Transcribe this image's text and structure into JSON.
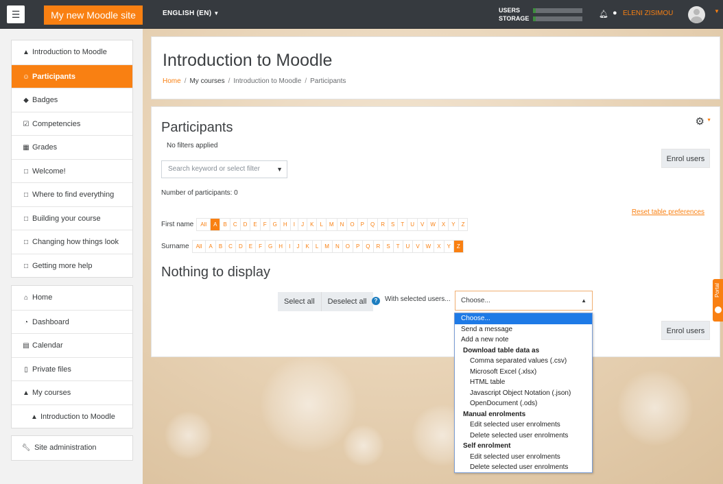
{
  "navbar": {
    "brand": "My new Moodle site",
    "language": "ENGLISH (EN)",
    "quota_users_label": "USERS",
    "quota_storage_label": "STORAGE",
    "quota_users_level": 0.05,
    "quota_storage_level": 0.05,
    "username": "ELENI ZISIMOU"
  },
  "drawer": {
    "course_items": [
      {
        "label": "Introduction to Moodle",
        "icon": "graduation-cap-icon",
        "active": false
      },
      {
        "label": "Participants",
        "icon": "users-icon",
        "active": true
      },
      {
        "label": "Badges",
        "icon": "shield-icon",
        "active": false
      },
      {
        "label": "Competencies",
        "icon": "checkbox-icon",
        "active": false
      },
      {
        "label": "Grades",
        "icon": "table-icon",
        "active": false
      },
      {
        "label": "Welcome!",
        "icon": "folder-icon",
        "active": false
      },
      {
        "label": "Where to find everything",
        "icon": "folder-icon",
        "active": false
      },
      {
        "label": "Building your course",
        "icon": "folder-icon",
        "active": false
      },
      {
        "label": "Changing how things look",
        "icon": "folder-icon",
        "active": false
      },
      {
        "label": "Getting more help",
        "icon": "folder-icon",
        "active": false
      }
    ],
    "site_items": [
      {
        "label": "Home",
        "icon": "home-icon"
      },
      {
        "label": "Dashboard",
        "icon": "dashboard-icon"
      },
      {
        "label": "Calendar",
        "icon": "calendar-icon"
      },
      {
        "label": "Private files",
        "icon": "file-icon"
      },
      {
        "label": "My courses",
        "icon": "graduation-cap-icon"
      },
      {
        "label": "Introduction to Moodle",
        "icon": "graduation-cap-icon"
      }
    ],
    "admin_item": {
      "label": "Site administration",
      "icon": "wrench-icon"
    }
  },
  "header": {
    "title": "Introduction to Moodle",
    "breadcrumb": [
      "Home",
      "My courses",
      "Introduction to Moodle",
      "Participants"
    ]
  },
  "participants": {
    "title": "Participants",
    "filters_status": "No filters applied",
    "search_placeholder": "Search keyword or select filter",
    "enrol_button": "Enrol users",
    "count_label": "Number of participants: 0",
    "reset_link": "Reset table preferences",
    "firstname_label": "First name",
    "surname_label": "Surname",
    "all_label": "All",
    "letters": [
      "A",
      "B",
      "C",
      "D",
      "E",
      "F",
      "G",
      "H",
      "I",
      "J",
      "K",
      "L",
      "M",
      "N",
      "O",
      "P",
      "Q",
      "R",
      "S",
      "T",
      "U",
      "V",
      "W",
      "X",
      "Y",
      "Z"
    ],
    "firstname_selected": "A",
    "surname_selected": "Z",
    "empty_message": "Nothing to display",
    "select_all": "Select all",
    "deselect_all": "Deselect all",
    "with_selected": "With selected users...",
    "select_value": "Choose..."
  },
  "bulk_options": [
    {
      "label": "Choose...",
      "kind": "highlighted"
    },
    {
      "label": "Send a message",
      "kind": "option"
    },
    {
      "label": "Add a new note",
      "kind": "option"
    },
    {
      "label": "Download table data as",
      "kind": "group"
    },
    {
      "label": "Comma separated values (.csv)",
      "kind": "sub"
    },
    {
      "label": "Microsoft Excel (.xlsx)",
      "kind": "sub"
    },
    {
      "label": "HTML table",
      "kind": "sub"
    },
    {
      "label": "Javascript Object Notation (.json)",
      "kind": "sub"
    },
    {
      "label": "OpenDocument (.ods)",
      "kind": "sub"
    },
    {
      "label": "Manual enrolments",
      "kind": "group"
    },
    {
      "label": "Edit selected user enrolments",
      "kind": "sub"
    },
    {
      "label": "Delete selected user enrolments",
      "kind": "sub"
    },
    {
      "label": "Self enrolment",
      "kind": "group"
    },
    {
      "label": "Edit selected user enrolments",
      "kind": "sub"
    },
    {
      "label": "Delete selected user enrolments",
      "kind": "sub"
    }
  ],
  "portal_tab": "Portal",
  "colors": {
    "brand": "#f98012",
    "navbar": "#363a3f",
    "highlight": "#1e7ae6",
    "help": "#1d7ec0"
  }
}
